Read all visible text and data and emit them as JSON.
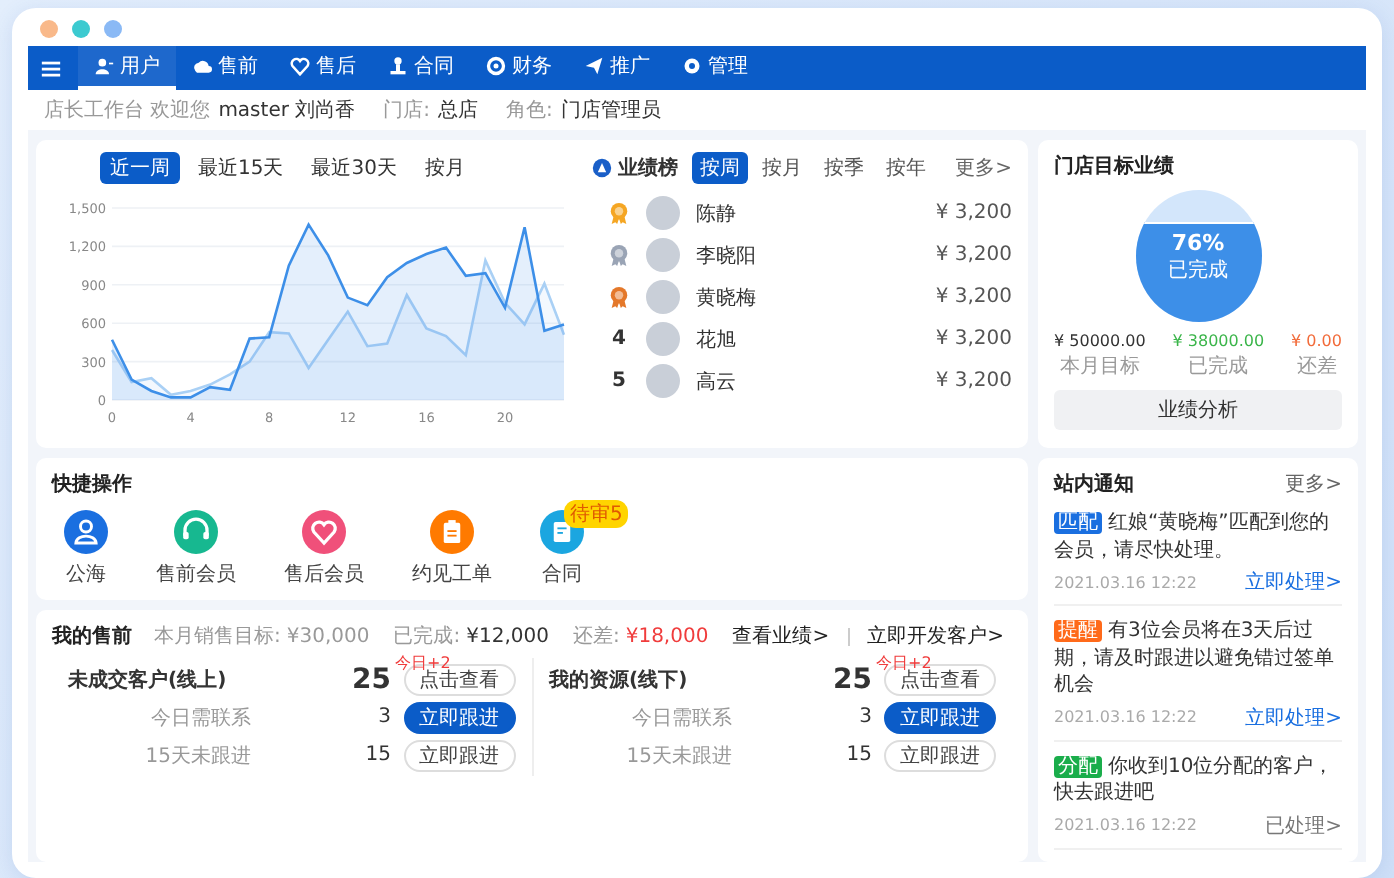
{
  "nav": {
    "items": [
      {
        "label": "用户",
        "selected": true
      },
      {
        "label": "售前",
        "selected": false
      },
      {
        "label": "售后",
        "selected": false
      },
      {
        "label": "合同",
        "selected": false
      },
      {
        "label": "财务",
        "selected": false
      },
      {
        "label": "推广",
        "selected": false
      },
      {
        "label": "管理",
        "selected": false
      }
    ]
  },
  "breadcrumb": {
    "welcome": "店长工作台 欢迎您",
    "user": "master 刘尚香",
    "store_label": "门店:",
    "store": "总店",
    "role_label": "角色:",
    "role": "门店管理员"
  },
  "trend": {
    "tabs": [
      {
        "label": "近一周",
        "selected": true
      },
      {
        "label": "最近15天",
        "selected": false
      },
      {
        "label": "最近30天",
        "selected": false
      },
      {
        "label": "按月",
        "selected": false
      }
    ],
    "chart_data": {
      "type": "area",
      "x": [
        0,
        1,
        2,
        3,
        4,
        5,
        6,
        7,
        8,
        9,
        10,
        11,
        12,
        13,
        14,
        15,
        16,
        17,
        18,
        19,
        20,
        21,
        22,
        23
      ],
      "xlim": [
        0,
        23
      ],
      "grid": true,
      "xticks": [
        0,
        4,
        8,
        12,
        16,
        20
      ],
      "ylim": [
        0,
        1500
      ],
      "yticks": [
        0,
        300,
        600,
        900,
        {
          "value": 1200,
          "label": "1,200"
        },
        {
          "value": 1500,
          "label": "1,500"
        }
      ],
      "series": [
        {
          "color": "#3d8fe8",
          "values": [
            470,
            160,
            70,
            20,
            20,
            100,
            80,
            480,
            490,
            1050,
            1370,
            1130,
            800,
            740,
            960,
            1070,
            1140,
            1190,
            970,
            990,
            720,
            1350,
            540,
            590
          ]
        },
        {
          "color": "#a9d0f5",
          "values": [
            390,
            140,
            170,
            40,
            70,
            120,
            200,
            300,
            530,
            520,
            250,
            470,
            690,
            420,
            440,
            820,
            560,
            500,
            350,
            1090,
            760,
            590,
            910,
            510
          ]
        }
      ]
    }
  },
  "leaderboard": {
    "title": "业绩榜",
    "tabs": [
      {
        "label": "按周",
        "selected": true
      },
      {
        "label": "按月",
        "selected": false
      },
      {
        "label": "按季",
        "selected": false
      },
      {
        "label": "按年",
        "selected": false
      }
    ],
    "more": "更多>",
    "rows": [
      {
        "kind": "medal",
        "color": "#f5a623",
        "name": "陈静",
        "amount": "¥ 3,200"
      },
      {
        "kind": "medal",
        "color": "#9aa4b5",
        "name": "李晓阳",
        "amount": "¥ 3,200"
      },
      {
        "kind": "medal",
        "color": "#e4782a",
        "name": "黄晓梅",
        "amount": "¥ 3,200"
      },
      {
        "kind": "number",
        "rank": "4",
        "name": "花旭",
        "amount": "¥ 3,200"
      },
      {
        "kind": "number",
        "rank": "5",
        "name": "高云",
        "amount": "¥ 3,200"
      }
    ]
  },
  "target": {
    "title": "门店目标业绩",
    "level": 0.76,
    "percent": "76%",
    "status": "已完成",
    "stats": [
      {
        "value": "¥ 50000.00",
        "label": "本月目标",
        "color": "#333333"
      },
      {
        "value": "¥ 38000.00",
        "label": "已完成",
        "color": "#3bb54a"
      },
      {
        "value": "¥ 0.00",
        "label": "还差",
        "color": "#f26b3a"
      }
    ],
    "button": "业绩分析"
  },
  "quick": {
    "title": "快捷操作",
    "items": [
      {
        "label": "公海",
        "color": "#1a6fe0"
      },
      {
        "label": "售前会员",
        "color": "#17b890"
      },
      {
        "label": "售后会员",
        "color": "#f0507a"
      },
      {
        "label": "约见工单",
        "color": "#ff7a00"
      },
      {
        "label": "合同",
        "color": "#1ba6e0",
        "badge": "待审5"
      }
    ]
  },
  "sales": {
    "title": "我的售前",
    "target_label": "本月销售目标:",
    "target": "¥30,000",
    "done_label": "已完成:",
    "done": "¥12,000",
    "left_label": "还差:",
    "left": "¥18,000",
    "link_1": "查看业绩>",
    "link_2": "立即开发客户>",
    "groups": [
      {
        "title": "未成交客户(线上)",
        "count": "25",
        "delta": "今日+2",
        "button": "点击查看",
        "rows": [
          {
            "label": "今日需联系",
            "count": "3",
            "button": "立即跟进",
            "primary": true
          },
          {
            "label": "15天未跟进",
            "count": "15",
            "button": "立即跟进",
            "primary": false
          }
        ]
      },
      {
        "title": "我的资源(线下)",
        "count": "25",
        "delta": "今日+2",
        "button": "点击查看",
        "rows": [
          {
            "label": "今日需联系",
            "count": "3",
            "button": "立即跟进",
            "primary": true
          },
          {
            "label": "15天未跟进",
            "count": "15",
            "button": "立即跟进",
            "primary": false
          }
        ]
      }
    ]
  },
  "notices": {
    "title": "站内通知",
    "more": "更多>",
    "items": [
      {
        "tag": "匹配",
        "color": "#1a6fe0",
        "text": "红娘“黄晓梅”匹配到您的会员，请尽快处理。",
        "time": "2021.03.16  12:22",
        "action": "立即处理>",
        "handled": false
      },
      {
        "tag": "提醒",
        "color": "#ff6a1a",
        "text": "有3位会员将在3天后过期，请及时跟进以避免错过签单机会",
        "time": "2021.03.16  12:22",
        "action": "立即处理>",
        "handled": false
      },
      {
        "tag": "分配",
        "color": "#1aad4b",
        "text": "你收到10位分配的客户，快去跟进吧",
        "time": "2021.03.16  12:22",
        "action": "已处理>",
        "handled": true
      }
    ]
  }
}
